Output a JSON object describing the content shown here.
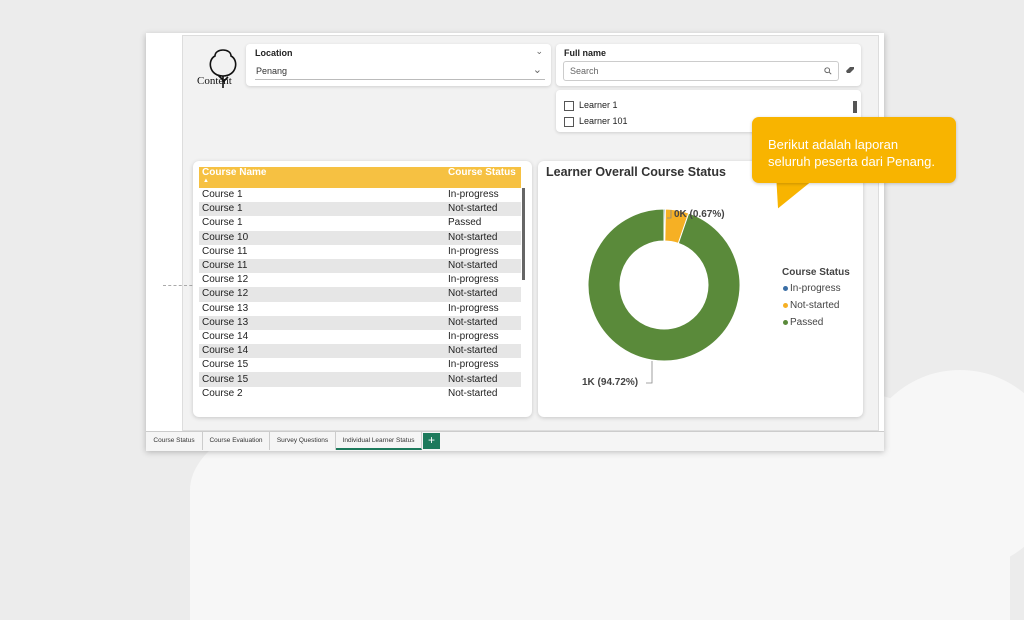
{
  "logo": {
    "text": "Content"
  },
  "location_slicer": {
    "title": "Location",
    "value": "Penang"
  },
  "fullname_slicer": {
    "title": "Full name",
    "search_placeholder": "Search",
    "items": [
      "Learner 1",
      "Learner 101"
    ]
  },
  "table": {
    "columns": [
      "Course Name",
      "Course Status"
    ],
    "rows": [
      [
        "Course 1",
        "In-progress"
      ],
      [
        "Course 1",
        "Not-started"
      ],
      [
        "Course 1",
        "Passed"
      ],
      [
        "Course 10",
        "Not-started"
      ],
      [
        "Course 11",
        "In-progress"
      ],
      [
        "Course 11",
        "Not-started"
      ],
      [
        "Course 12",
        "In-progress"
      ],
      [
        "Course 12",
        "Not-started"
      ],
      [
        "Course 13",
        "In-progress"
      ],
      [
        "Course 13",
        "Not-started"
      ],
      [
        "Course 14",
        "In-progress"
      ],
      [
        "Course 14",
        "Not-started"
      ],
      [
        "Course 15",
        "In-progress"
      ],
      [
        "Course 15",
        "Not-started"
      ],
      [
        "Course 2",
        "Not-started"
      ]
    ]
  },
  "chart_data": {
    "type": "pie",
    "title": "Learner Overall Course Status",
    "legend_title": "Course Status",
    "legend_position": "right",
    "categories": [
      "In-progress",
      "Not-started",
      "Passed"
    ],
    "percent": [
      0.3,
      4.98,
      94.72
    ],
    "colors": [
      "#3a6ea5",
      "#f6b024",
      "#5a8a3a"
    ],
    "data_labels": [
      {
        "category": "Not-started",
        "text": "0K (0.67%)"
      },
      {
        "category": "Passed",
        "text": "1K (94.72%)"
      }
    ]
  },
  "tabs": [
    "Course Status",
    "Course Evaluation",
    "Survey Questions",
    "Individual Learner Status"
  ],
  "active_tab": "Individual Learner Status",
  "add_tab_label": "+",
  "callout": {
    "line1": "Berikut adalah laporan",
    "line2": "seluruh peserta dari Penang."
  }
}
